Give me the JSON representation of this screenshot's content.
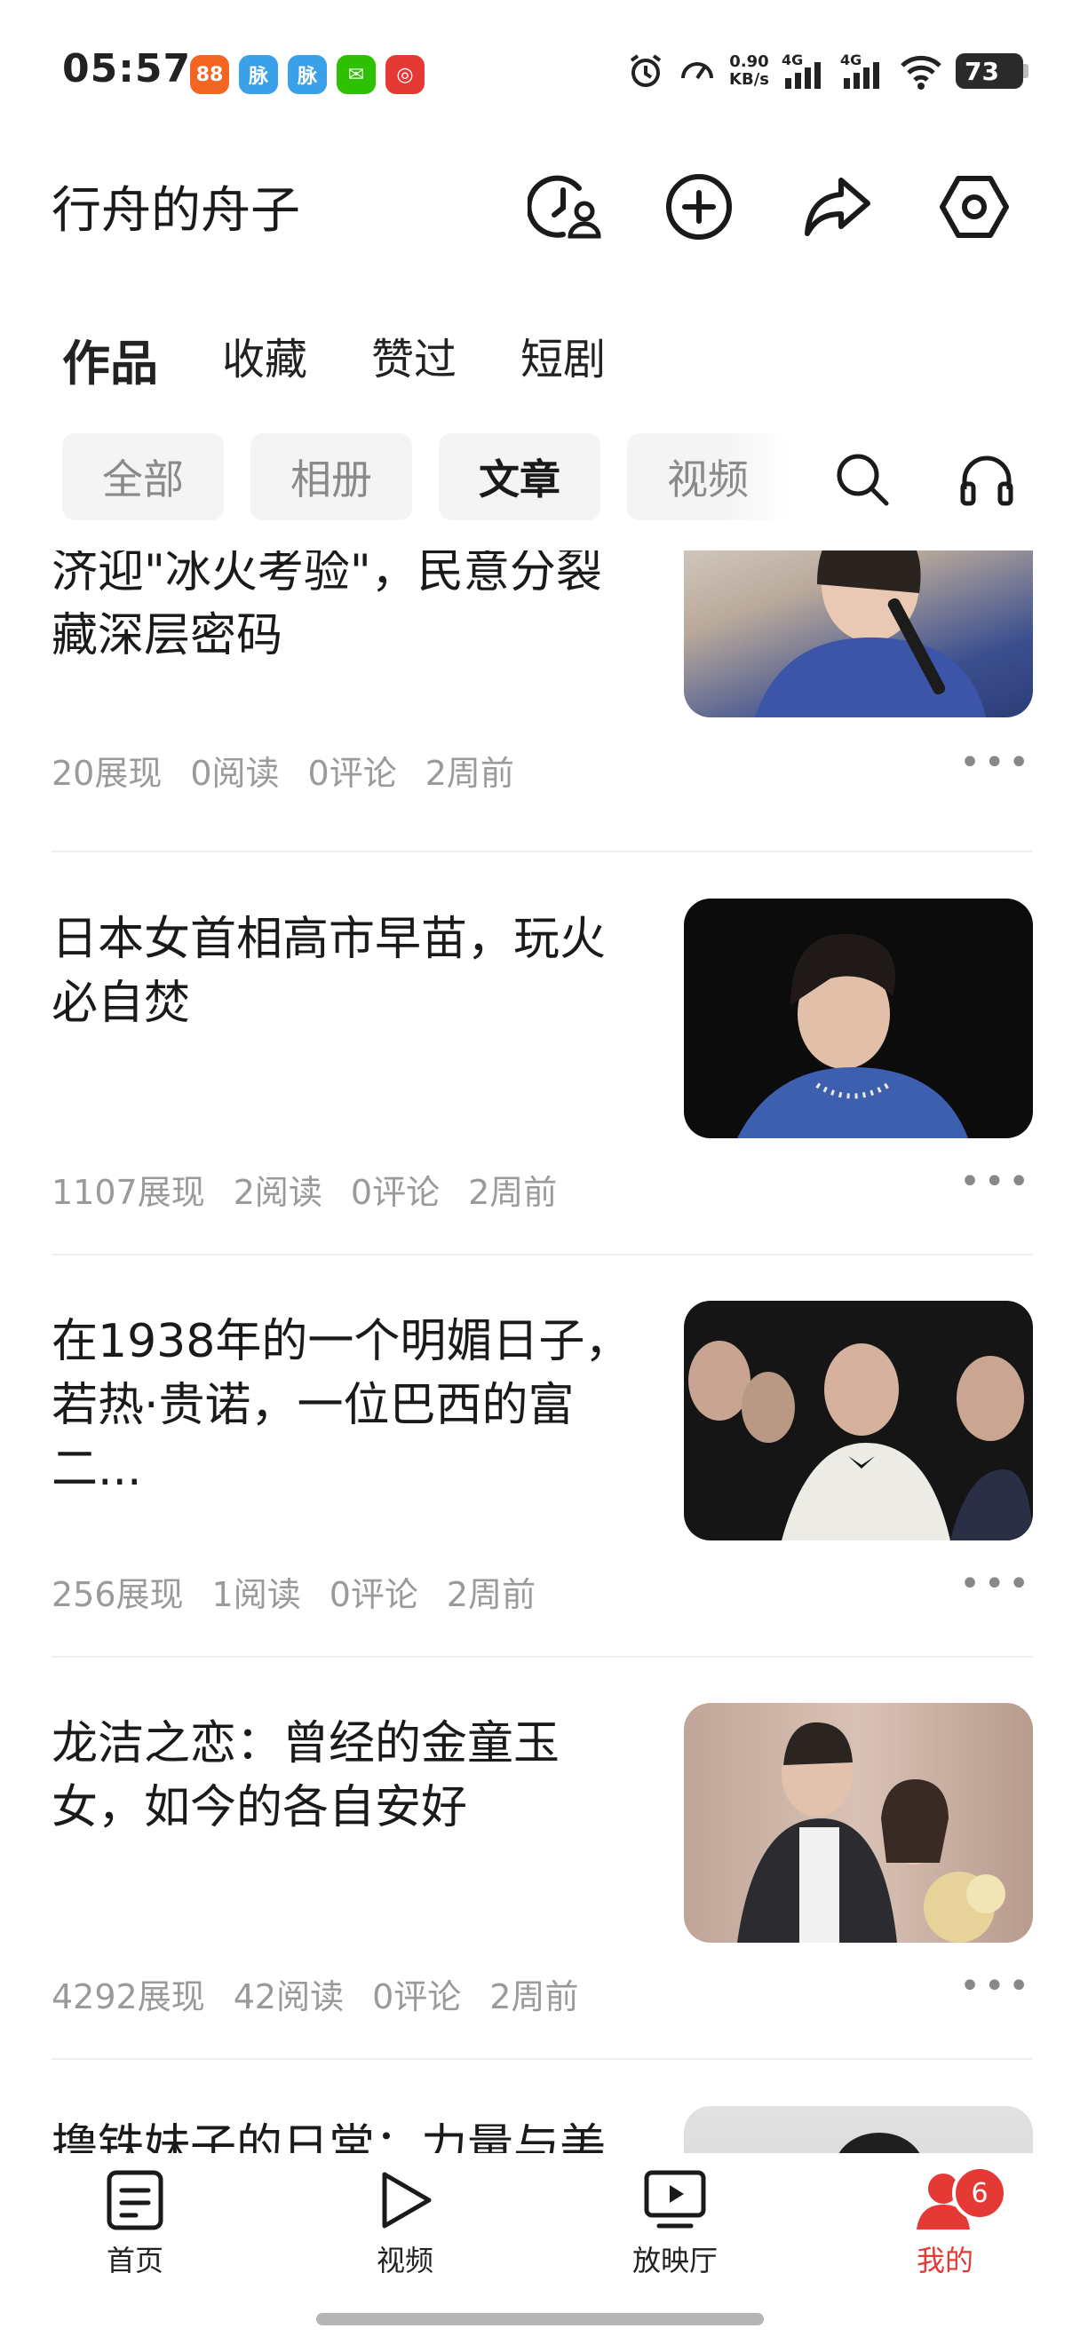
{
  "status_bar": {
    "time": "05:57",
    "net_speed_value": "0.90",
    "net_speed_unit": "KB/s",
    "signal1": "4G",
    "signal2": "4G",
    "battery": "73",
    "app_icons": [
      {
        "name": "orange-app-icon",
        "color": "#f26522",
        "glyph": "88"
      },
      {
        "name": "maimai-icon",
        "color": "#3aa0e8",
        "glyph": "脉"
      },
      {
        "name": "maimai-icon-2",
        "color": "#3aa0e8",
        "glyph": "脉"
      },
      {
        "name": "wechat-icon",
        "color": "#2dc100",
        "glyph": "✉"
      },
      {
        "name": "netease-music-icon",
        "color": "#e53935",
        "glyph": "◎"
      }
    ]
  },
  "header": {
    "username": "行舟的舟子"
  },
  "main_tabs": [
    {
      "label": "作品",
      "active": true
    },
    {
      "label": "收藏",
      "active": false
    },
    {
      "label": "赞过",
      "active": false
    },
    {
      "label": "短剧",
      "active": false
    }
  ],
  "chips": [
    {
      "label": "全部",
      "active": false
    },
    {
      "label": "相册",
      "active": false
    },
    {
      "label": "文章",
      "active": true
    },
    {
      "label": "视频",
      "active": false
    }
  ],
  "articles": [
    {
      "title_lines": [
        "济迎\"冰火考验\"，民意分裂",
        "藏深层密码"
      ],
      "views": "20展现",
      "reads": "0阅读",
      "comments": "0评论",
      "time": "2周前",
      "thumb_colors": [
        "#3b4f8f",
        "#c9b8a8"
      ]
    },
    {
      "title_lines": [
        "日本女首相高市早苗，玩火",
        "必自焚"
      ],
      "views": "1107展现",
      "reads": "2阅读",
      "comments": "0评论",
      "time": "2周前",
      "thumb_colors": [
        "#0c0c0c",
        "#3c5fb0"
      ]
    },
    {
      "title_lines": [
        "在1938年的一个明媚日子，",
        "若热·贵诺，一位巴西的富",
        "二..."
      ],
      "views": "256展现",
      "reads": "1阅读",
      "comments": "0评论",
      "time": "2周前",
      "thumb_colors": [
        "#151515",
        "#e8e4dc"
      ]
    },
    {
      "title_lines": [
        "龙洁之恋：曾经的金童玉",
        "女，如今的各自安好"
      ],
      "views": "4292展现",
      "reads": "42阅读",
      "comments": "0评论",
      "time": "2周前",
      "thumb_colors": [
        "#c8a89a",
        "#2c2c30"
      ]
    },
    {
      "title_lines": [
        "撸铁妹子的日常：力量与美"
      ],
      "thumb_colors": [
        "#d9d9d9",
        "#222222"
      ]
    }
  ],
  "bottom_nav": [
    {
      "label": "首页",
      "icon": "article-doc-icon",
      "active": false
    },
    {
      "label": "视频",
      "icon": "play-triangle-icon",
      "active": false
    },
    {
      "label": "放映厅",
      "icon": "tv-play-icon",
      "active": false
    },
    {
      "label": "我的",
      "icon": "profile-person-icon",
      "active": true,
      "badge": "6"
    }
  ],
  "colors": {
    "accent_red": "#e53935",
    "chip_bg": "#f4f4f4",
    "meta_gray": "#9a9a9a"
  }
}
